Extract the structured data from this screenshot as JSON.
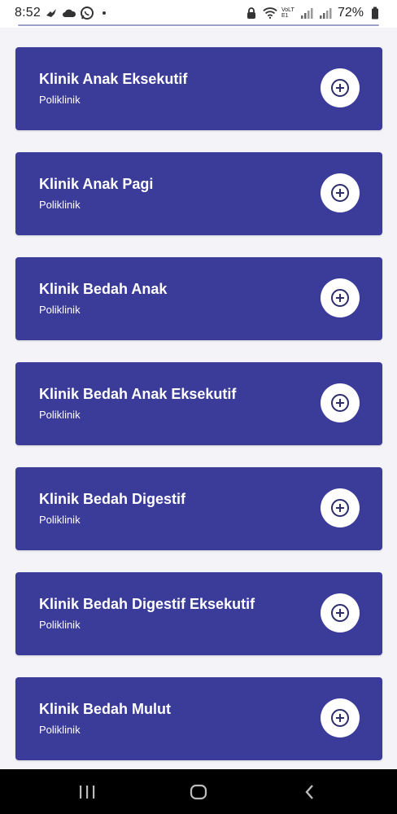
{
  "status_bar": {
    "time": "8:52",
    "battery_percent": "72%",
    "network_label": "VoLTE1",
    "icons": [
      "bird-notification-icon",
      "cloud-icon",
      "whatsapp-icon",
      "lock-icon",
      "wifi-icon",
      "signal-icon",
      "battery-icon"
    ]
  },
  "colors": {
    "card_background": "#3b3b99",
    "page_background": "#f4f4f8",
    "button_background": "#ffffff",
    "accent_divider": "#9da0c9"
  },
  "clinics": [
    {
      "name": "Klinik Anak Eksekutif",
      "category": "Poliklinik"
    },
    {
      "name": "Klinik Anak Pagi",
      "category": "Poliklinik"
    },
    {
      "name": "Klinik Bedah Anak",
      "category": "Poliklinik"
    },
    {
      "name": "Klinik Bedah Anak Eksekutif",
      "category": "Poliklinik"
    },
    {
      "name": "Klinik Bedah Digestif",
      "category": "Poliklinik"
    },
    {
      "name": "Klinik Bedah Digestif Eksekutif",
      "category": "Poliklinik"
    },
    {
      "name": "Klinik Bedah Mulut",
      "category": "Poliklinik"
    }
  ],
  "nav_bar": {
    "buttons": [
      "recent-apps-icon",
      "home-icon",
      "back-icon"
    ]
  }
}
